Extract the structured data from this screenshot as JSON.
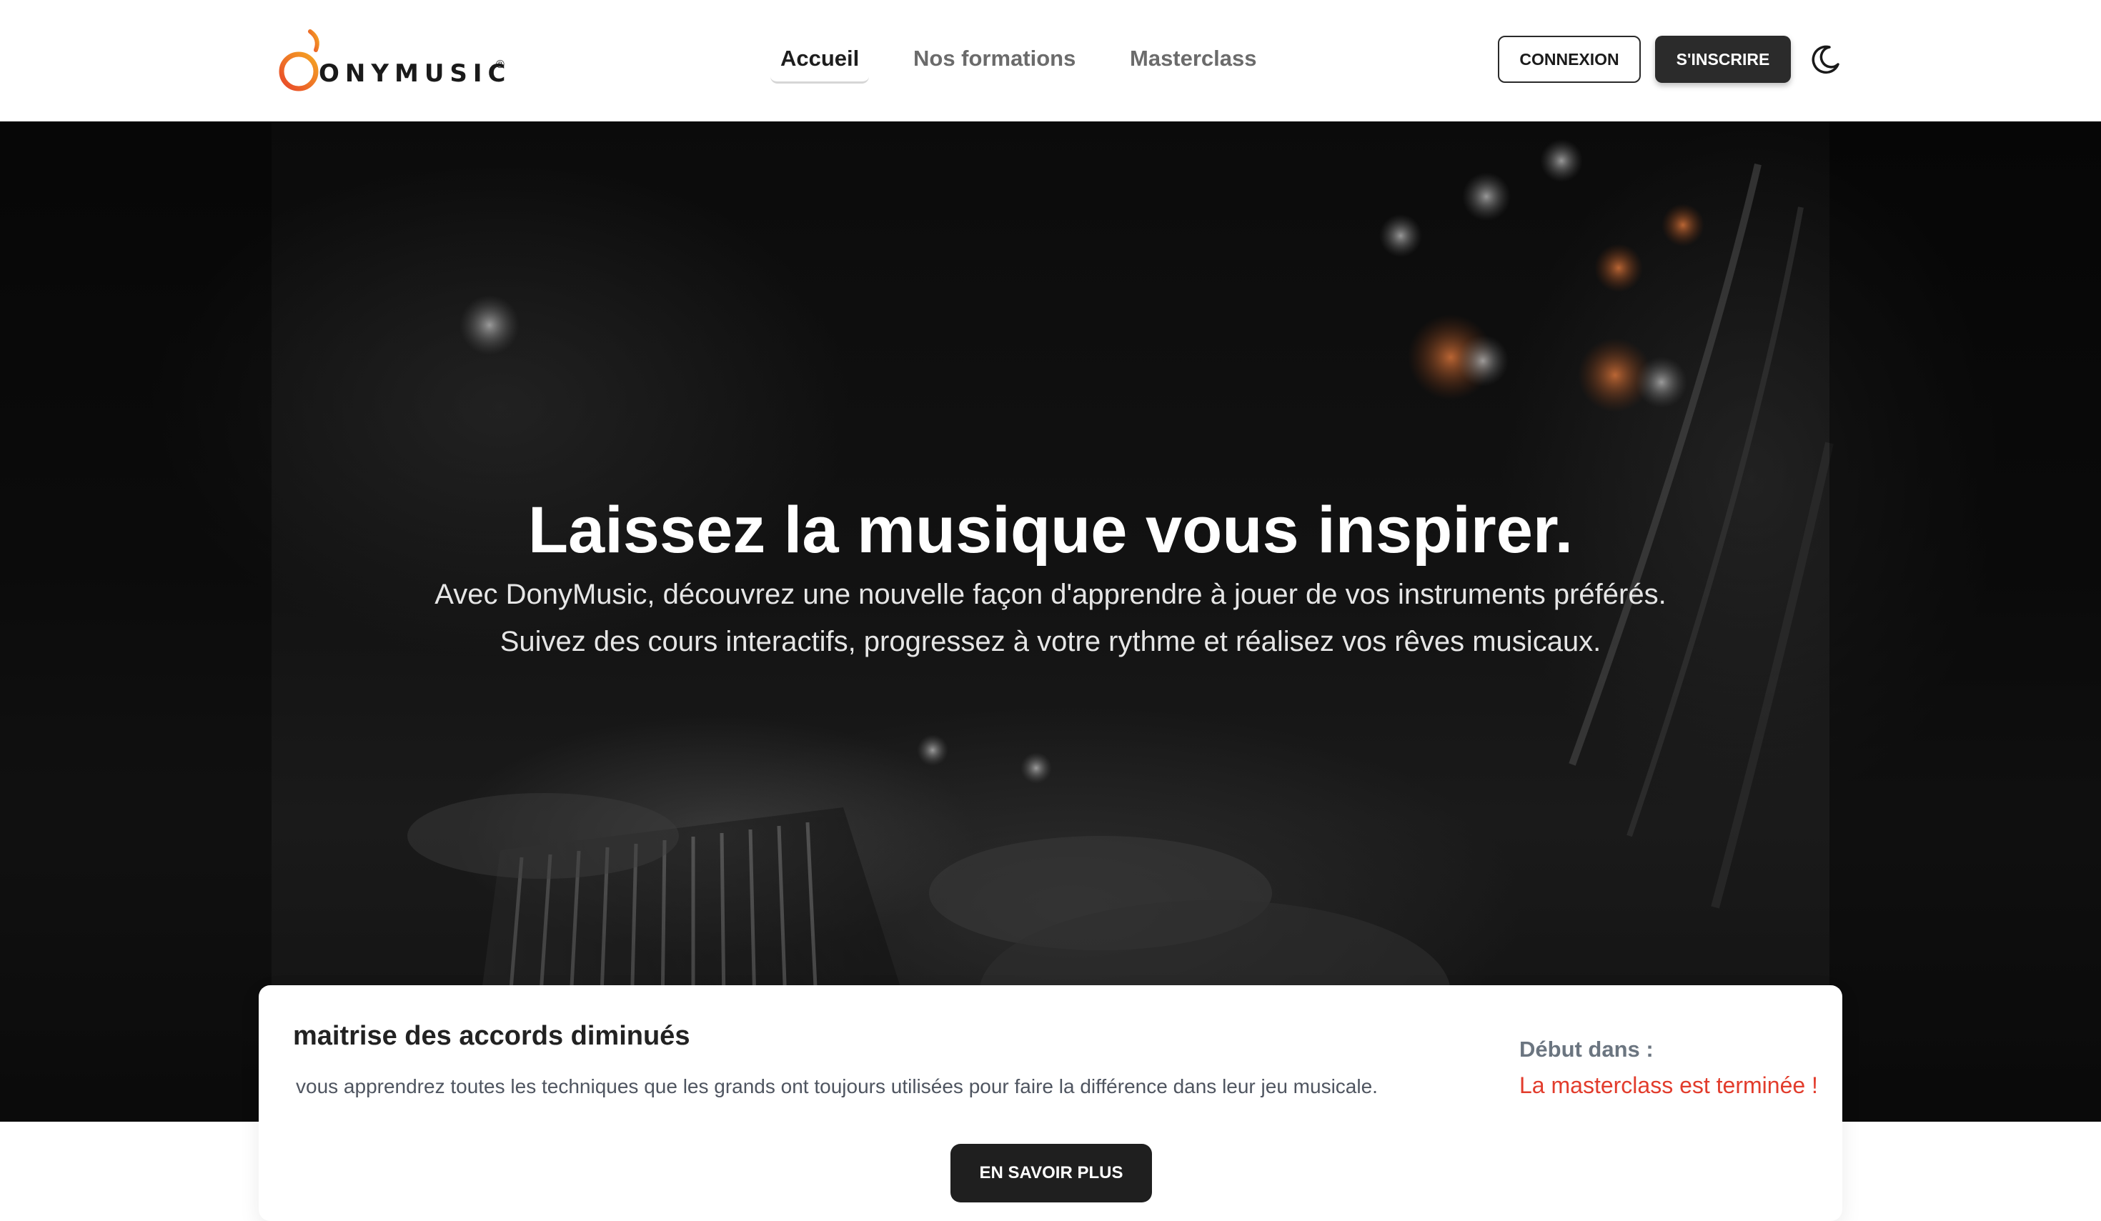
{
  "brand": {
    "name": "ONYMUSIC",
    "registered": "®",
    "accent_orange": "#f26a2e",
    "accent_yellow": "#f5a623"
  },
  "nav": {
    "items": [
      {
        "label": "Accueil",
        "active": true
      },
      {
        "label": "Nos formations",
        "active": false
      },
      {
        "label": "Masterclass",
        "active": false
      }
    ]
  },
  "header_actions": {
    "login_label": "CONNEXION",
    "signup_label": "S'INSCRIRE",
    "theme_icon": "moon-icon"
  },
  "hero": {
    "title": "Laissez la musique vous inspirer.",
    "subtitle_line1": "Avec DonyMusic, découvrez une nouvelle façon d'apprendre à jouer de vos instruments préférés.",
    "subtitle_line2": "Suivez des cours interactifs, progressez à votre rythme et réalisez vos rêves musicaux."
  },
  "masterclass_card": {
    "title": "maitrise des accords diminués",
    "description": "vous apprendrez toutes les techniques que les grands ont toujours utilisées pour faire la différence dans leur jeu musicale.",
    "countdown_label": "Début dans :",
    "countdown_status": "La masterclass est terminée !",
    "status_color": "#e23c2c",
    "cta_label": "EN SAVOIR PLUS"
  }
}
